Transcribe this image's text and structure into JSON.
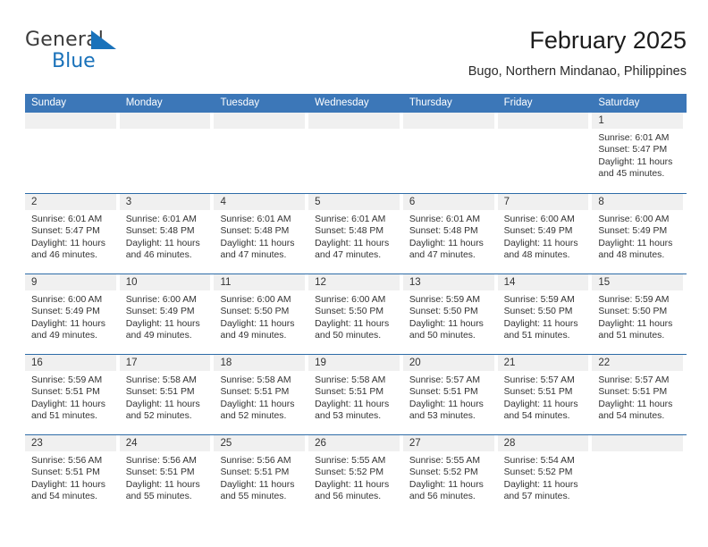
{
  "brand": {
    "name_part1": "General",
    "name_part2": "Blue",
    "triangle_color": "#1a72ba"
  },
  "header": {
    "title": "February 2025",
    "subtitle": "Bugo, Northern Mindanao, Philippines"
  },
  "theme": {
    "header_blue": "#3c77b8",
    "row_rule_blue": "#2e6ca8",
    "day_band_gray": "#f0f0f0",
    "text_color": "#333333"
  },
  "calendar": {
    "weekday_headers": [
      "Sunday",
      "Monday",
      "Tuesday",
      "Wednesday",
      "Thursday",
      "Friday",
      "Saturday"
    ],
    "weeks": [
      [
        {
          "date": "",
          "empty": true
        },
        {
          "date": "",
          "empty": true
        },
        {
          "date": "",
          "empty": true
        },
        {
          "date": "",
          "empty": true
        },
        {
          "date": "",
          "empty": true
        },
        {
          "date": "",
          "empty": true
        },
        {
          "date": "1",
          "sunrise": "Sunrise: 6:01 AM",
          "sunset": "Sunset: 5:47 PM",
          "daylight": "Daylight: 11 hours and 45 minutes."
        }
      ],
      [
        {
          "date": "2",
          "sunrise": "Sunrise: 6:01 AM",
          "sunset": "Sunset: 5:47 PM",
          "daylight": "Daylight: 11 hours and 46 minutes."
        },
        {
          "date": "3",
          "sunrise": "Sunrise: 6:01 AM",
          "sunset": "Sunset: 5:48 PM",
          "daylight": "Daylight: 11 hours and 46 minutes."
        },
        {
          "date": "4",
          "sunrise": "Sunrise: 6:01 AM",
          "sunset": "Sunset: 5:48 PM",
          "daylight": "Daylight: 11 hours and 47 minutes."
        },
        {
          "date": "5",
          "sunrise": "Sunrise: 6:01 AM",
          "sunset": "Sunset: 5:48 PM",
          "daylight": "Daylight: 11 hours and 47 minutes."
        },
        {
          "date": "6",
          "sunrise": "Sunrise: 6:01 AM",
          "sunset": "Sunset: 5:48 PM",
          "daylight": "Daylight: 11 hours and 47 minutes."
        },
        {
          "date": "7",
          "sunrise": "Sunrise: 6:00 AM",
          "sunset": "Sunset: 5:49 PM",
          "daylight": "Daylight: 11 hours and 48 minutes."
        },
        {
          "date": "8",
          "sunrise": "Sunrise: 6:00 AM",
          "sunset": "Sunset: 5:49 PM",
          "daylight": "Daylight: 11 hours and 48 minutes."
        }
      ],
      [
        {
          "date": "9",
          "sunrise": "Sunrise: 6:00 AM",
          "sunset": "Sunset: 5:49 PM",
          "daylight": "Daylight: 11 hours and 49 minutes."
        },
        {
          "date": "10",
          "sunrise": "Sunrise: 6:00 AM",
          "sunset": "Sunset: 5:49 PM",
          "daylight": "Daylight: 11 hours and 49 minutes."
        },
        {
          "date": "11",
          "sunrise": "Sunrise: 6:00 AM",
          "sunset": "Sunset: 5:50 PM",
          "daylight": "Daylight: 11 hours and 49 minutes."
        },
        {
          "date": "12",
          "sunrise": "Sunrise: 6:00 AM",
          "sunset": "Sunset: 5:50 PM",
          "daylight": "Daylight: 11 hours and 50 minutes."
        },
        {
          "date": "13",
          "sunrise": "Sunrise: 5:59 AM",
          "sunset": "Sunset: 5:50 PM",
          "daylight": "Daylight: 11 hours and 50 minutes."
        },
        {
          "date": "14",
          "sunrise": "Sunrise: 5:59 AM",
          "sunset": "Sunset: 5:50 PM",
          "daylight": "Daylight: 11 hours and 51 minutes."
        },
        {
          "date": "15",
          "sunrise": "Sunrise: 5:59 AM",
          "sunset": "Sunset: 5:50 PM",
          "daylight": "Daylight: 11 hours and 51 minutes."
        }
      ],
      [
        {
          "date": "16",
          "sunrise": "Sunrise: 5:59 AM",
          "sunset": "Sunset: 5:51 PM",
          "daylight": "Daylight: 11 hours and 51 minutes."
        },
        {
          "date": "17",
          "sunrise": "Sunrise: 5:58 AM",
          "sunset": "Sunset: 5:51 PM",
          "daylight": "Daylight: 11 hours and 52 minutes."
        },
        {
          "date": "18",
          "sunrise": "Sunrise: 5:58 AM",
          "sunset": "Sunset: 5:51 PM",
          "daylight": "Daylight: 11 hours and 52 minutes."
        },
        {
          "date": "19",
          "sunrise": "Sunrise: 5:58 AM",
          "sunset": "Sunset: 5:51 PM",
          "daylight": "Daylight: 11 hours and 53 minutes."
        },
        {
          "date": "20",
          "sunrise": "Sunrise: 5:57 AM",
          "sunset": "Sunset: 5:51 PM",
          "daylight": "Daylight: 11 hours and 53 minutes."
        },
        {
          "date": "21",
          "sunrise": "Sunrise: 5:57 AM",
          "sunset": "Sunset: 5:51 PM",
          "daylight": "Daylight: 11 hours and 54 minutes."
        },
        {
          "date": "22",
          "sunrise": "Sunrise: 5:57 AM",
          "sunset": "Sunset: 5:51 PM",
          "daylight": "Daylight: 11 hours and 54 minutes."
        }
      ],
      [
        {
          "date": "23",
          "sunrise": "Sunrise: 5:56 AM",
          "sunset": "Sunset: 5:51 PM",
          "daylight": "Daylight: 11 hours and 54 minutes."
        },
        {
          "date": "24",
          "sunrise": "Sunrise: 5:56 AM",
          "sunset": "Sunset: 5:51 PM",
          "daylight": "Daylight: 11 hours and 55 minutes."
        },
        {
          "date": "25",
          "sunrise": "Sunrise: 5:56 AM",
          "sunset": "Sunset: 5:51 PM",
          "daylight": "Daylight: 11 hours and 55 minutes."
        },
        {
          "date": "26",
          "sunrise": "Sunrise: 5:55 AM",
          "sunset": "Sunset: 5:52 PM",
          "daylight": "Daylight: 11 hours and 56 minutes."
        },
        {
          "date": "27",
          "sunrise": "Sunrise: 5:55 AM",
          "sunset": "Sunset: 5:52 PM",
          "daylight": "Daylight: 11 hours and 56 minutes."
        },
        {
          "date": "28",
          "sunrise": "Sunrise: 5:54 AM",
          "sunset": "Sunset: 5:52 PM",
          "daylight": "Daylight: 11 hours and 57 minutes."
        },
        {
          "date": "",
          "empty": true
        }
      ]
    ]
  }
}
